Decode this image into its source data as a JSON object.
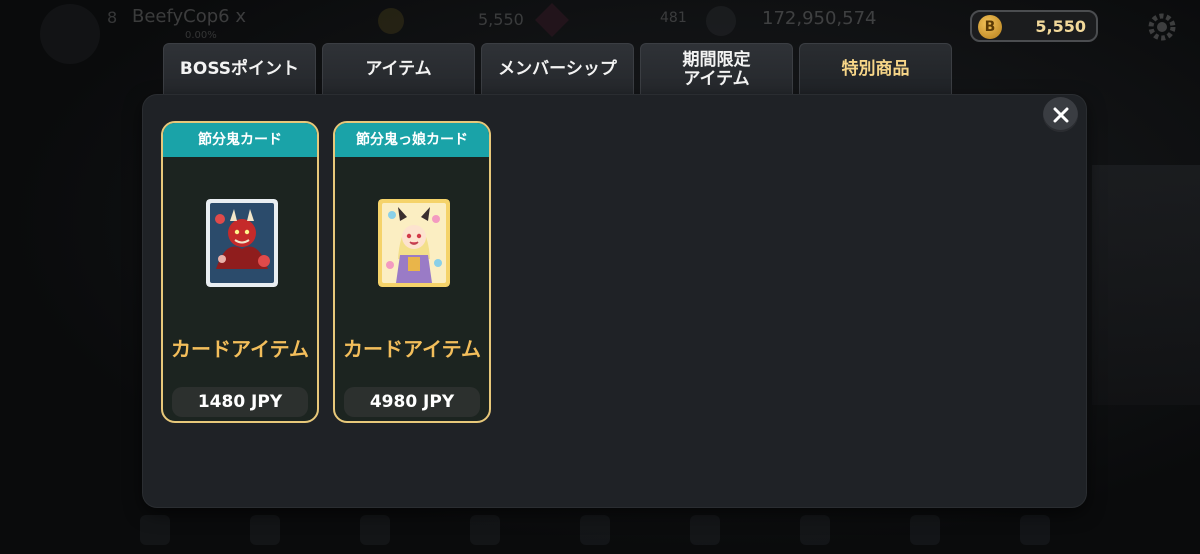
{
  "background": {
    "player_level": "8",
    "player_name": "BeefyCop6 x",
    "player_sub": "0.00%",
    "coin_balance": "5,550",
    "gem_balance": "481",
    "chip_balance": "172,950,574"
  },
  "header": {
    "currency_icon": "B",
    "currency_value": "5,550"
  },
  "tabs": [
    {
      "label": "BOSSポイント",
      "active": false
    },
    {
      "label": "アイテム",
      "active": false
    },
    {
      "label": "メンバーシップ",
      "active": false
    },
    {
      "label": "期間限定\nアイテム",
      "active": false
    },
    {
      "label": "特別商品",
      "active": true
    }
  ],
  "products": [
    {
      "title": "節分鬼カード",
      "type_label": "カードアイテム",
      "price": "1480 JPY",
      "image": "red-oni-card"
    },
    {
      "title": "節分鬼っ娘カード",
      "type_label": "カードアイテム",
      "price": "4980 JPY",
      "image": "oni-girl-card"
    }
  ],
  "colors": {
    "accent_gold": "#e7c87a",
    "card_header": "#1aa3a8",
    "type_label": "#f3be5b",
    "panel_bg": "#1f2226"
  }
}
